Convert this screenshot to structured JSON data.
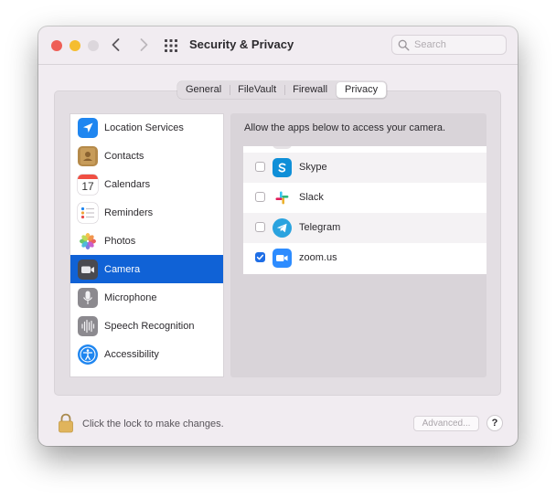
{
  "window": {
    "title": "Security & Privacy"
  },
  "search": {
    "placeholder": "Search",
    "icon": "magnifying-glass"
  },
  "tabs": [
    {
      "label": "General",
      "selected": false
    },
    {
      "label": "FileVault",
      "selected": false
    },
    {
      "label": "Firewall",
      "selected": false
    },
    {
      "label": "Privacy",
      "selected": true
    }
  ],
  "sidebar": {
    "items": [
      {
        "label": "Location Services",
        "icon": "location-arrow",
        "selected": false
      },
      {
        "label": "Contacts",
        "icon": "contacts-book",
        "selected": false
      },
      {
        "label": "Calendars",
        "icon": "calendar",
        "selected": false,
        "icon_text": "17"
      },
      {
        "label": "Reminders",
        "icon": "reminders-list",
        "selected": false
      },
      {
        "label": "Photos",
        "icon": "photos-flower",
        "selected": false
      },
      {
        "label": "Camera",
        "icon": "camera",
        "selected": true
      },
      {
        "label": "Microphone",
        "icon": "microphone",
        "selected": false
      },
      {
        "label": "Speech Recognition",
        "icon": "waveform",
        "selected": false
      },
      {
        "label": "Accessibility",
        "icon": "accessibility-person",
        "selected": false
      }
    ]
  },
  "content": {
    "heading": "Allow the apps below to access your camera.",
    "apps": [
      {
        "name": "Skype",
        "icon": "skype",
        "checked": false
      },
      {
        "name": "Slack",
        "icon": "slack",
        "checked": false
      },
      {
        "name": "Telegram",
        "icon": "telegram",
        "checked": false
      },
      {
        "name": "zoom.us",
        "icon": "zoom",
        "checked": true
      }
    ]
  },
  "footer": {
    "lock_text": "Click the lock to make changes.",
    "advanced_label": "Advanced...",
    "help_label": "?"
  },
  "colors": {
    "selection": "#1062d6",
    "accent": "#1e6ee6",
    "window_bg": "#f1ecf1"
  }
}
